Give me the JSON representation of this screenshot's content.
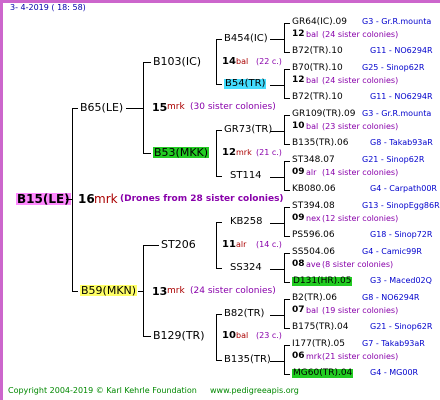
{
  "header": {
    "date_line": "3-   4-2019  ( 18:  58)"
  },
  "footer": {
    "copyright": "Copyright 2004-2019 © Karl Kehrle Foundation",
    "site": "www.pedigreeapis.org"
  },
  "root": {
    "name": "B15(LE)",
    "num": "16",
    "mark": "mrk",
    "note": "(Drones from 28 sister colonies)"
  },
  "sire": {
    "name": "B65(LE)",
    "num": "15",
    "mark": "mrk",
    "note": "(30 sister colonies)"
  },
  "dam": {
    "name": "B59(MKN)",
    "num": "13",
    "mark": "mrk",
    "note": "(24 sister colonies)"
  },
  "s_sire": {
    "name": "B103(IC)",
    "num": "14",
    "mark": "bal",
    "note": "(22 c.)"
  },
  "s_dam": {
    "name": "B53(MKK)",
    "num": "12",
    "mark": "mrk",
    "note": "(21 c.)"
  },
  "d_sire": {
    "name": "ST206",
    "num": "11",
    "mark": "alr",
    "note": "(14 c.)"
  },
  "d_dam": {
    "name": "B129(TR)",
    "num": "10",
    "mark": "bal",
    "note": "(23 c.)"
  },
  "g3": [
    {
      "name": "B454(IC)"
    },
    {
      "name": "B54(TR)"
    },
    {
      "name": "GR73(TR)"
    },
    {
      "name": "ST114"
    },
    {
      "name": "KB258"
    },
    {
      "name": "SS324"
    },
    {
      "name": "B82(TR)"
    },
    {
      "name": "B135(TR)"
    }
  ],
  "leaves": [
    {
      "l1": "GR64(IC).09",
      "r1": "G3 - Gr.R.mounta",
      "num": "12",
      "mark": "bal",
      "note": "(24 sister colonies)",
      "l2": "B72(TR).10",
      "r2": "G11 - NO6294R"
    },
    {
      "l1": "B70(TR).10",
      "r1": "G25 - Sinop62R",
      "num": "12",
      "mark": "bal",
      "note": "(24 sister colonies)",
      "l2": "B72(TR).10",
      "r2": "G11 - NO6294R"
    },
    {
      "l1": "GR109(TR).09",
      "r1": "G3 - Gr.R.mounta",
      "num": "10",
      "mark": "bal",
      "note": "(23 sister colonies)",
      "l2": "B135(TR).06",
      "r2": "G8 - Takab93aR"
    },
    {
      "l1": "ST348.07",
      "r1": "G21 - Sinop62R",
      "num": "09",
      "mark": "alr",
      "note": "(14 sister colonies)",
      "l2": "KB080.06",
      "r2": "G4 - Carpath00R"
    },
    {
      "l1": "ST394.08",
      "r1": "G13 - SinopEgg86R",
      "num": "09",
      "mark": "nex",
      "note": "(12 sister colonies)",
      "l2": "PS596.06",
      "r2": "G18 - Sinop72R"
    },
    {
      "l1": "SS504.06",
      "r1": "G4 - Camic99R",
      "num": "08",
      "mark": "ave",
      "note": "(8 sister colonies)",
      "l2": "D131(HR).05",
      "r2": "G3 - Maced02Q"
    },
    {
      "l1": "B2(TR).06",
      "r1": "G8 - NO6294R",
      "num": "07",
      "mark": "bal",
      "note": "(19 sister colonies)",
      "l2": "B175(TR).04",
      "r2": "G21 - Sinop62R"
    },
    {
      "l1": "I177(TR).05",
      "r1": "G7 - Takab93aR",
      "num": "06",
      "mark": "mrk",
      "note": "(21 sister colonies)",
      "l2": "MG60(TR).04",
      "r2": "G4 - MG00R"
    }
  ]
}
